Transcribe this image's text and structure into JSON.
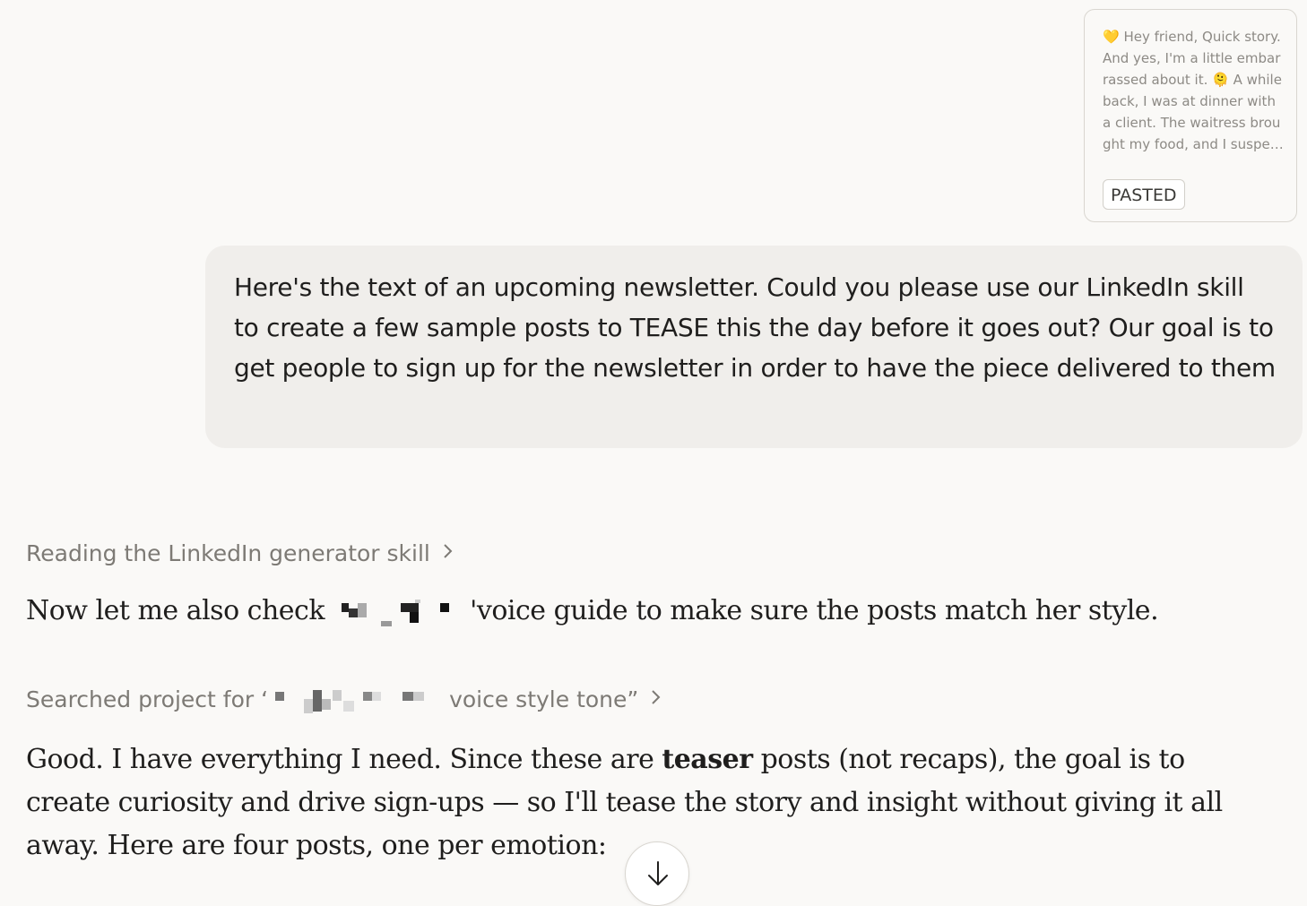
{
  "attachment": {
    "preview_text": "💛 Hey friend, Quick story. And yes, I'm a little embarrassed about it. 🫠 A while back, I was at dinner with a client. The waitress brought my food, and I suspected",
    "badge": "PASTED"
  },
  "user_message": {
    "text": "Here's the text of an upcoming newsletter. Could you please use our LinkedIn skill to create a few sample posts to TEASE this the day before it goes out? Our goal is to get people to sign up for the newsletter in order to have the piece delivered to them"
  },
  "tool_steps": [
    {
      "label": "Reading the LinkedIn generator skill",
      "icon": "chevron-right-icon"
    },
    {
      "prefix": "Searched project for ‘",
      "suffix": "voice style tone”",
      "icon": "chevron-right-icon"
    }
  ],
  "assistant": {
    "check_prefix": "Now let me also check",
    "check_suffix": "'voice guide to make sure the posts match her style.",
    "good_part1": "Good. I have everything I need. Since these are ",
    "good_bold": "teaser",
    "good_part2": " posts (not recaps), the goal is to create curiosity and drive sign-ups — so I'll tease the story and insight without giving it all away. Here are four posts, one per emotion:"
  },
  "scroll_button": {
    "icon": "arrow-down-icon"
  }
}
